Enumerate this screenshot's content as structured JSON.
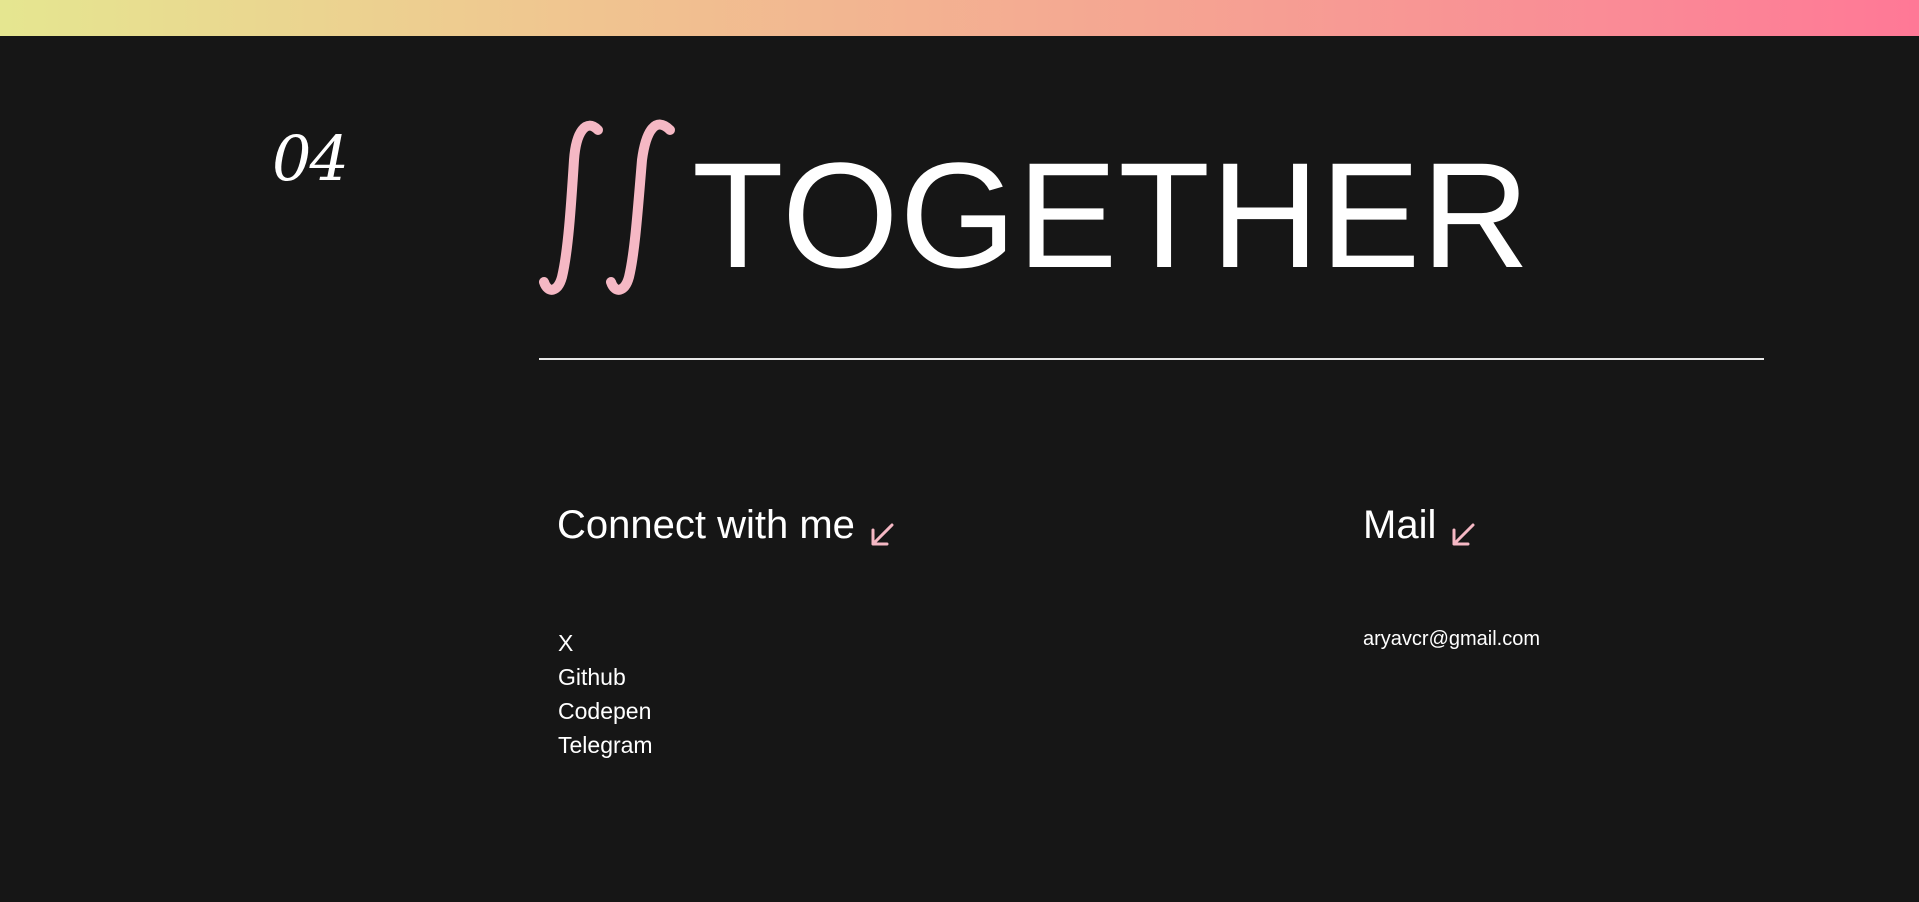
{
  "section": {
    "number": "04",
    "title": "TOGETHER"
  },
  "connect": {
    "heading": "Connect with me",
    "links": [
      "X",
      "Github",
      "Codepen",
      "Telegram"
    ]
  },
  "mail": {
    "heading": "Mail",
    "address": "aryavcr@gmail.com"
  },
  "icons": {
    "heading_mark": "double-integral-icon",
    "arrow": "arrow-down-left-icon"
  },
  "colors": {
    "background": "#161616",
    "accent_pink": "#f5b8c4",
    "gradient_start": "#e5e690",
    "gradient_end": "#ff7896",
    "text": "#ffffff"
  }
}
